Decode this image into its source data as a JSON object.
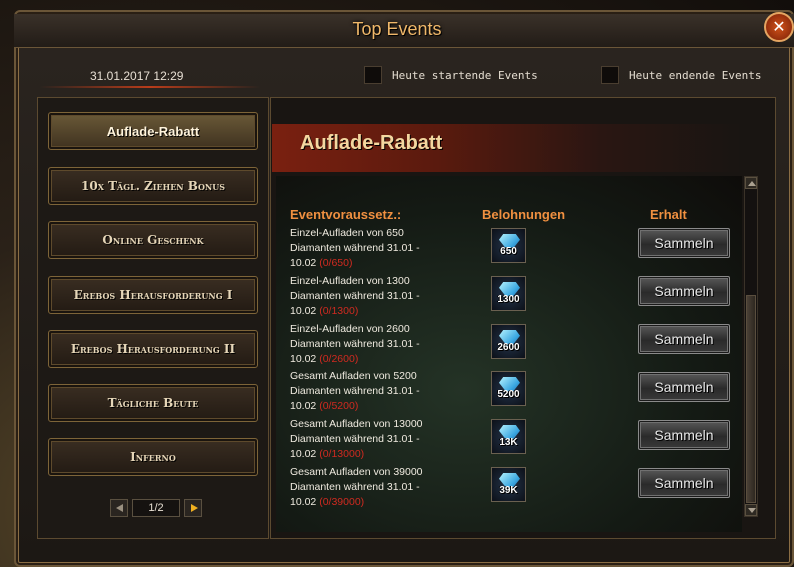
{
  "window": {
    "title": "Top Events",
    "close_label": "✕"
  },
  "header": {
    "datetime": "31.01.2017 12:29",
    "filters": [
      {
        "label": "Heute startende Events",
        "checked": false
      },
      {
        "label": "Heute endende Events",
        "checked": false
      }
    ]
  },
  "sidebar": {
    "items": [
      {
        "label": "Auflade-Rabatt",
        "active": true
      },
      {
        "label": "10x Tägl. Ziehen Bonus",
        "active": false
      },
      {
        "label": "Online Geschenk",
        "active": false
      },
      {
        "label": "Erebos Herausforderung I",
        "active": false
      },
      {
        "label": "Erebos Herausforderung II",
        "active": false
      },
      {
        "label": "Tägliche Beute",
        "active": false
      },
      {
        "label": "Inferno",
        "active": false
      }
    ],
    "pager": {
      "label": "1/2"
    }
  },
  "content": {
    "title": "Auflade-Rabatt",
    "columns": {
      "condition": "Eventvoraussetz.:",
      "reward": "Belohnungen",
      "claim": "Erhalt"
    },
    "rows": [
      {
        "line1": "Einzel-Aufladen von 650",
        "line2": "Diamanten während 31.01 -",
        "line3": "10.02",
        "progress": "(0/650)",
        "reward": "650",
        "button": "Sammeln"
      },
      {
        "line1": "Einzel-Aufladen von 1300",
        "line2": "Diamanten während 31.01 -",
        "line3": "10.02",
        "progress": "(0/1300)",
        "reward": "1300",
        "button": "Sammeln"
      },
      {
        "line1": "Einzel-Aufladen von 2600",
        "line2": "Diamanten während 31.01 -",
        "line3": "10.02",
        "progress": "(0/2600)",
        "reward": "2600",
        "button": "Sammeln"
      },
      {
        "line1": "Gesamt Aufladen von 5200",
        "line2": "Diamanten während 31.01 -",
        "line3": "10.02",
        "progress": "(0/5200)",
        "reward": "5200",
        "button": "Sammeln"
      },
      {
        "line1": "Gesamt Aufladen von 13000",
        "line2": "Diamanten während 31.01 -",
        "line3": "10.02",
        "progress": "(0/13000)",
        "reward": "13K",
        "button": "Sammeln"
      },
      {
        "line1": "Gesamt Aufladen von 39000",
        "line2": "Diamanten während 31.01 -",
        "line3": "10.02",
        "progress": "(0/39000)",
        "reward": "39K",
        "button": "Sammeln"
      }
    ]
  },
  "icons": {
    "reward": "diamond-icon",
    "close": "close-icon",
    "prev": "arrow-left-icon",
    "next": "arrow-right-icon"
  },
  "colors": {
    "accent": "#f0b86a",
    "progress": "#d02a20",
    "column_header": "#f09040"
  }
}
